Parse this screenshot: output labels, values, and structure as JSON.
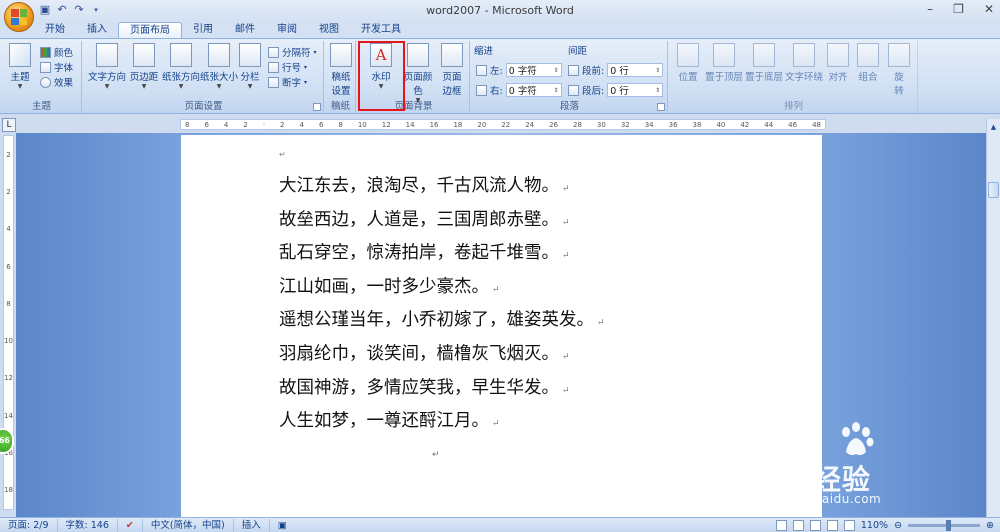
{
  "window": {
    "title": "word2007 - Microsoft Word",
    "controls": [
      "–",
      "❐",
      "✕"
    ]
  },
  "quick_access": [
    "save-icon",
    "undo-icon",
    "redo-icon"
  ],
  "tabs": [
    {
      "label": "开始"
    },
    {
      "label": "插入"
    },
    {
      "label": "页面布局",
      "active": true
    },
    {
      "label": "引用"
    },
    {
      "label": "邮件"
    },
    {
      "label": "审阅"
    },
    {
      "label": "视图"
    },
    {
      "label": "开发工具"
    }
  ],
  "ribbon": {
    "theme_group": {
      "label": "主题",
      "big_button": "主题",
      "items": [
        "颜色",
        "字体",
        "效果"
      ]
    },
    "page_setup_group": {
      "label": "页面设置",
      "buttons": [
        "文字方向",
        "页边距",
        "纸张方向",
        "纸张大小",
        "分栏"
      ],
      "small_items": [
        "分隔符",
        "行号",
        "断字"
      ]
    },
    "draft_group": {
      "label": "稿纸",
      "button_line1": "稿纸",
      "button_line2": "设置"
    },
    "page_background_group": {
      "label": "页面背景",
      "watermark": "水印",
      "page_color": "页面颜色",
      "page_border_line1": "页面",
      "page_border_line2": "边框"
    },
    "paragraph_group": {
      "label": "段落",
      "indent_title": "缩进",
      "spacing_title": "间距",
      "indent_left_label": "左:",
      "indent_left_value": "0 字符",
      "indent_right_label": "右:",
      "indent_right_value": "0 字符",
      "spacing_before_label": "段前:",
      "spacing_before_value": "0 行",
      "spacing_after_label": "段后:",
      "spacing_after_value": "0 行"
    },
    "arrange_group": {
      "label": "排列",
      "buttons": [
        "位置",
        "置于顶层",
        "置于底层",
        "文字环绕",
        "对齐",
        "组合"
      ],
      "rotate_line1": "旋",
      "rotate_line2": "转"
    }
  },
  "ruler": {
    "numbers": [
      "8",
      "6",
      "4",
      "2",
      "",
      "2",
      "4",
      "6",
      "8",
      "10",
      "12",
      "14",
      "16",
      "18",
      "20",
      "22",
      "24",
      "26",
      "28",
      "30",
      "32",
      "34",
      "36",
      "38",
      "40",
      "42",
      "44",
      "46",
      "48"
    ],
    "vertical_numbers": [
      "2",
      "2",
      "4",
      "6",
      "8",
      "10",
      "12",
      "14",
      "16",
      "18"
    ],
    "corner": "L"
  },
  "document": {
    "paragraph_mark": "↵",
    "lines": [
      "大江东去，浪淘尽，千古风流人物。",
      "故垒西边，人道是，三国周郎赤壁。",
      "乱石穿空，惊涛拍岸，卷起千堆雪。",
      "江山如画，一时多少豪杰。",
      "遥想公瑾当年，小乔初嫁了，雄姿英发。",
      "羽扇纶巾，谈笑间，樯橹灰飞烟灭。",
      "故国神游，多情应笑我，早生华发。",
      "人生如梦，一尊还酹江月。"
    ]
  },
  "status_bar": {
    "page": "页面: 2/9",
    "words": "字数: 146",
    "language": "中文(简体，中国)",
    "mode": "插入",
    "zoom": "110%",
    "zoom_level": 110
  },
  "side_badge": "66",
  "watermark": {
    "brand": "Bai经验",
    "url": "jingyan.baidu.com"
  },
  "colors": {
    "highlight_box": "#e8141b",
    "ribbon_text": "#15428b",
    "doc_background": "#7aa3de"
  }
}
